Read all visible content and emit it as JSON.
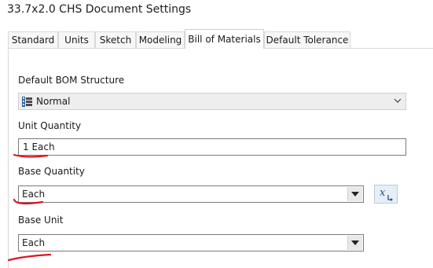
{
  "window": {
    "title": "33.7x2.0 CHS Document Settings"
  },
  "tabs": [
    {
      "label": "Standard",
      "active": false
    },
    {
      "label": "Units",
      "active": false
    },
    {
      "label": "Sketch",
      "active": false
    },
    {
      "label": "Modeling",
      "active": false
    },
    {
      "label": "Bill of Materials",
      "active": true
    },
    {
      "label": "Default Tolerance",
      "active": false
    }
  ],
  "bom": {
    "structure": {
      "label": "Default BOM Structure",
      "value": "Normal",
      "icon": "bom-structure-icon"
    },
    "unit_quantity": {
      "label": "Unit Quantity",
      "value": "1 Each"
    },
    "base_quantity": {
      "label": "Base Quantity",
      "value": "Each",
      "function_button_icon": "fx-function-icon"
    },
    "base_unit": {
      "label": "Base Unit",
      "value": "Each"
    }
  },
  "annotations": {
    "underline_color": "#e0141e"
  },
  "colors": {
    "panel_border": "#d9d9d9",
    "field_border": "#7a7a7a"
  }
}
